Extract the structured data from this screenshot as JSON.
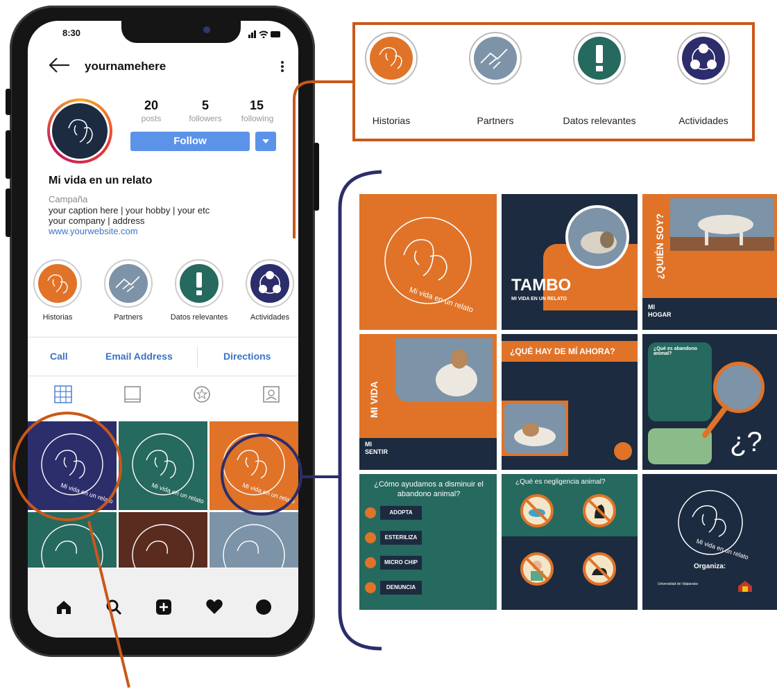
{
  "status": {
    "time": "8:30"
  },
  "profile": {
    "username": "yournamehere",
    "stats": [
      {
        "num": "20",
        "label": "posts"
      },
      {
        "num": "5",
        "label": "followers"
      },
      {
        "num": "15",
        "label": "following"
      }
    ],
    "follow_label": "Follow",
    "name": "Mi vida en un relato",
    "category": "Campaña",
    "bio_line1": "your caption here  | your hobby | your etc",
    "bio_line2": "your company | address",
    "website": "www.yourwebsite.com",
    "logo_text": "Mi vida en un relato"
  },
  "highlights": [
    {
      "label": "Historias",
      "color": "#e07328",
      "icon": "dog-cat-logo-icon"
    },
    {
      "label": "Partners",
      "color": "#7d93a8",
      "icon": "handshake-icon"
    },
    {
      "label": "Datos relevantes",
      "color": "#26695e",
      "icon": "exclamation-icon"
    },
    {
      "label": "Actividades",
      "color": "#2c2d6b",
      "icon": "activities-icon"
    }
  ],
  "actions": {
    "call": "Call",
    "email": "Email Address",
    "directions": "Directions"
  },
  "tabs": [
    "grid-icon",
    "igtv-icon",
    "tagged-star-icon",
    "profile-tag-icon"
  ],
  "bottom_nav": [
    "home-icon",
    "search-icon",
    "add-post-icon",
    "heart-icon",
    "profile-icon"
  ],
  "colors": {
    "orange": "#e07328",
    "navy": "#1c2b3f",
    "teal": "#26695e",
    "slate": "#7d93a8",
    "brown": "#5a2b1f",
    "accent": "#c9581a"
  },
  "posts": {
    "tambo_title": "TAMBO",
    "tambo_sub": "MI VIDA EN UN RELATO",
    "quien_soy": "¿QUIÉN SOY?",
    "mi_hogar": "MI\nHOGAR",
    "mi_vida": "MI VIDA",
    "mi_sentir": "MI\nSENTIR",
    "que_hay": "¿QUÉ HAY DE MÍ AHORA?",
    "abandono_q": "¿Qué es abandono animal?",
    "como_ayudamos": "¿Cómo ayudamos a disminuir el abandono animal?",
    "ayuda_items": [
      "ADOPTA",
      "ESTERILIZA",
      "MICRO CHIP",
      "DENUNCIA"
    ],
    "negligencia": "¿Qué es negligencia animal?",
    "organiza": "Organiza:",
    "uv": "Universidad de Valparaíso"
  }
}
